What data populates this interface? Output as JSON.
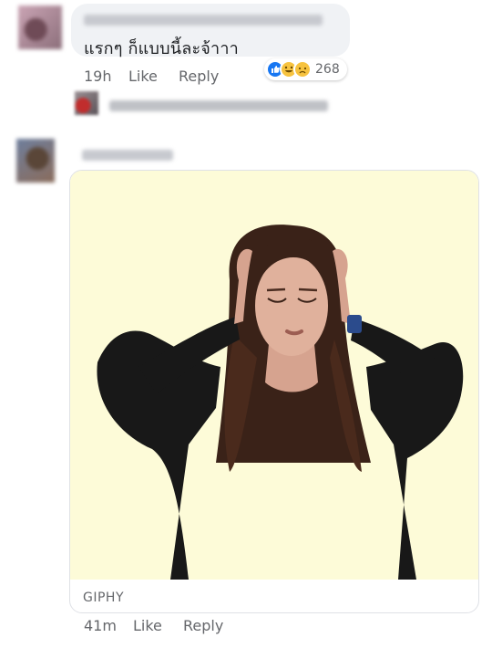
{
  "comment1": {
    "text": "แรกๆ ก็แบบนี้ละจ้าาา",
    "time": "19h",
    "like_label": "Like",
    "reply_label": "Reply",
    "reactions": {
      "icons": [
        "like-icon",
        "haha-icon",
        "sad-icon"
      ],
      "count": "268"
    }
  },
  "comment2": {
    "gif_source": "GIPHY",
    "time": "41m",
    "like_label": "Like",
    "reply_label": "Reply"
  },
  "colors": {
    "bubble_bg": "#f0f2f5",
    "meta_text": "#65676b",
    "like_blue": "#1877f2",
    "gif_bg": "#fdfbd8"
  }
}
